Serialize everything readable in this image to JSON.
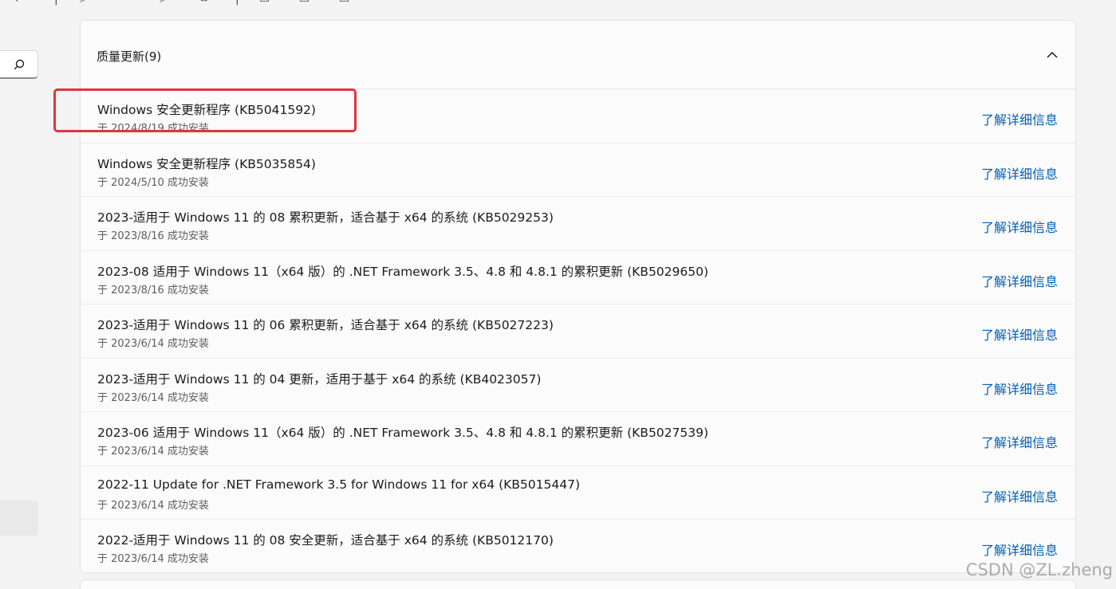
{
  "header": {
    "title": "质量更新(9)"
  },
  "updates": [
    {
      "title": "Windows 安全更新程序 (KB5041592)",
      "date": "于 2024/8/19 成功安装",
      "link": "了解详细信息"
    },
    {
      "title": "Windows 安全更新程序 (KB5035854)",
      "date": "于 2024/5/10 成功安装",
      "link": "了解详细信息"
    },
    {
      "title": "2023-适用于 Windows 11 的 08 累积更新，适合基于 x64 的系统 (KB5029253)",
      "date": "于 2023/8/16 成功安装",
      "link": "了解详细信息"
    },
    {
      "title": "2023-08 适用于 Windows 11（x64 版）的 .NET Framework 3.5、4.8 和 4.8.1 的累积更新 (KB5029650)",
      "date": "于 2023/8/16 成功安装",
      "link": "了解详细信息"
    },
    {
      "title": "2023-适用于 Windows 11 的 06 累积更新，适合基于 x64 的系统 (KB5027223)",
      "date": "于 2023/6/14 成功安装",
      "link": "了解详细信息"
    },
    {
      "title": "2023-适用于 Windows 11 的 04 更新，适用于基于 x64 的系统 (KB4023057)",
      "date": "于 2023/6/14 成功安装",
      "link": "了解详细信息"
    },
    {
      "title": "2023-06 适用于 Windows 11（x64 版）的 .NET Framework 3.5、4.8 和 4.8.1 的累积更新 (KB5027539)",
      "date": "于 2023/6/14 成功安装",
      "link": "了解详细信息"
    },
    {
      "title": "2022-11 Update for .NET Framework 3.5 for Windows 11 for x64 (KB5015447)",
      "date": "于 2023/6/14 成功安装",
      "link": "了解详细信息"
    },
    {
      "title": "2022-适用于 Windows 11 的 08 安全更新，适合基于 x64 的系统 (KB5012170)",
      "date": "于 2023/6/14 成功安装",
      "link": "了解详细信息"
    }
  ],
  "watermark": "CSDN @ZL.zheng",
  "colors": {
    "link": "#005fb8",
    "highlight": "#e0353a"
  }
}
